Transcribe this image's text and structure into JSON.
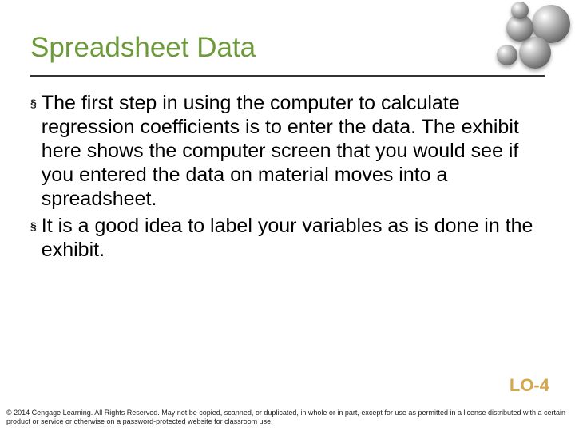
{
  "title": "Spreadsheet Data",
  "bullets": [
    "The first step in using the computer to calculate regression coefficients is to enter the data. The exhibit here shows the computer screen that you would see if you entered the data on material moves into a spreadsheet.",
    "It is a good idea to label your variables as is done in the exhibit."
  ],
  "lo_label": "LO-4",
  "footer": "© 2014 Cengage Learning. All Rights Reserved. May not be copied, scanned, or duplicated, in whole or in part, except for use as permitted in a license distributed with a certain product or service or otherwise on a password-protected website for classroom use."
}
